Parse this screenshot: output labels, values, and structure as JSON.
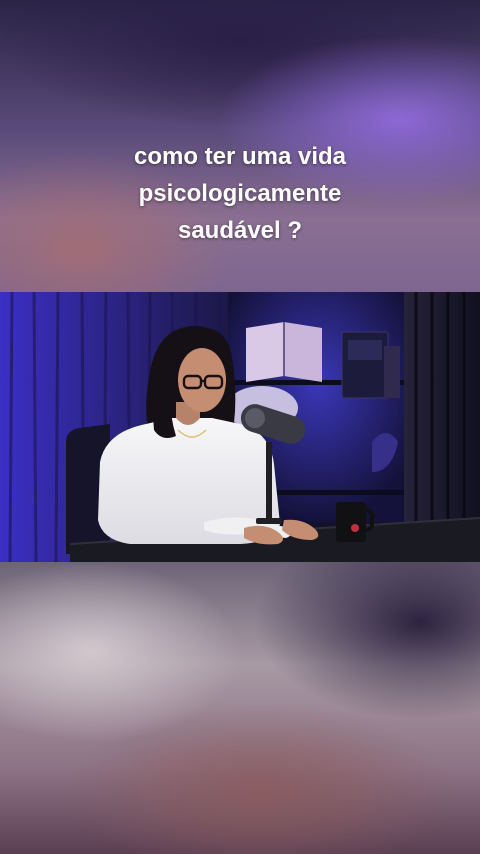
{
  "caption": {
    "lines": [
      "como ter uma vida",
      "psicologicamente",
      "saudável ?"
    ]
  },
  "colors": {
    "caption_text": "#ffffff",
    "curtain_purple": "#4a3ad0",
    "shirt_white": "#f2f2f2"
  }
}
